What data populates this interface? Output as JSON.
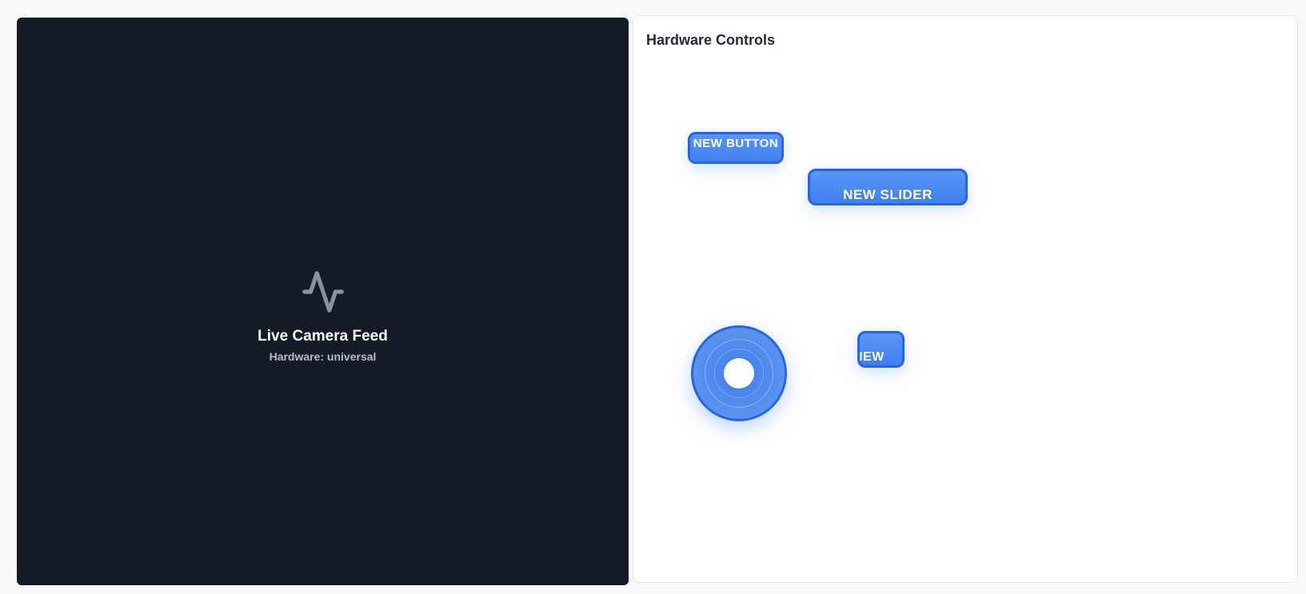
{
  "camera": {
    "title": "Live Camera Feed",
    "subtitle": "Hardware: universal",
    "icon": "activity-pulse-icon"
  },
  "controls": {
    "title": "Hardware Controls",
    "buttons": [
      {
        "label": "NEW BUTTON"
      },
      {
        "label": "NEW SLIDER"
      },
      {
        "label": "NEW"
      }
    ],
    "joystick": {
      "name": "joystick"
    }
  },
  "colors": {
    "camera_bg": "#131a28",
    "accent": "#3b82f6",
    "accent_border": "#2563eb"
  }
}
